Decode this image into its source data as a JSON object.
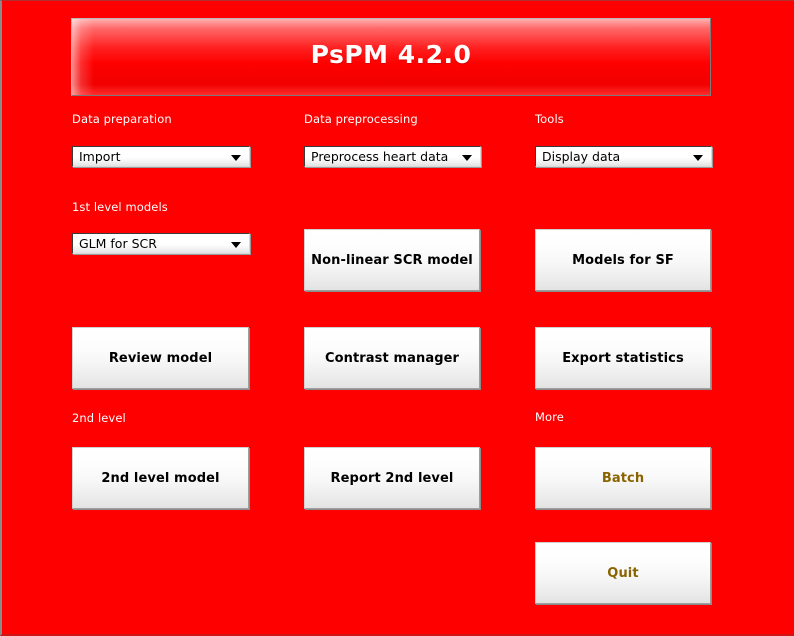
{
  "window": {
    "background_color": "#ff0000"
  },
  "header": {
    "title": "PsPM 4.2.0",
    "text_color": "#ffffff"
  },
  "columns": [
    {
      "name": "column-1",
      "sections": [
        {
          "label": "Data preparation"
        },
        {
          "label": "1st level models"
        },
        {
          "label": "2nd level"
        }
      ]
    },
    {
      "name": "column-2",
      "sections": [
        {
          "label": "Data preprocessing"
        }
      ]
    },
    {
      "name": "column-3",
      "sections": [
        {
          "label": "Tools"
        },
        {
          "label": "More"
        }
      ]
    }
  ],
  "labels": {
    "data_preparation": "Data preparation",
    "data_preprocessing": "Data preprocessing",
    "tools": "Tools",
    "first_level_models": "1st level models",
    "second_level": "2nd level",
    "more": "More"
  },
  "dropdowns": {
    "import": {
      "selected": "Import",
      "icon": "chevron-down-icon"
    },
    "preprocess_heart_data": {
      "selected": "Preprocess heart data",
      "icon": "chevron-down-icon"
    },
    "display_data": {
      "selected": "Display data",
      "icon": "chevron-down-icon"
    },
    "glm_for_scr": {
      "selected": "GLM for SCR",
      "icon": "chevron-down-icon"
    }
  },
  "buttons": {
    "non_linear_scr_model": {
      "label": "Non-linear SCR model",
      "text_color": "#000000"
    },
    "models_for_sf": {
      "label": "Models for SF",
      "text_color": "#000000"
    },
    "review_model": {
      "label": "Review model",
      "text_color": "#000000"
    },
    "contrast_manager": {
      "label": "Contrast manager",
      "text_color": "#000000"
    },
    "export_statistics": {
      "label": "Export statistics",
      "text_color": "#000000"
    },
    "second_level_model": {
      "label": "2nd level model",
      "text_color": "#000000"
    },
    "report_2nd_level": {
      "label": "Report 2nd level",
      "text_color": "#000000"
    },
    "batch": {
      "label": "Batch",
      "text_color": "#8a6400"
    },
    "quit": {
      "label": "Quit",
      "text_color": "#8a6400"
    }
  }
}
